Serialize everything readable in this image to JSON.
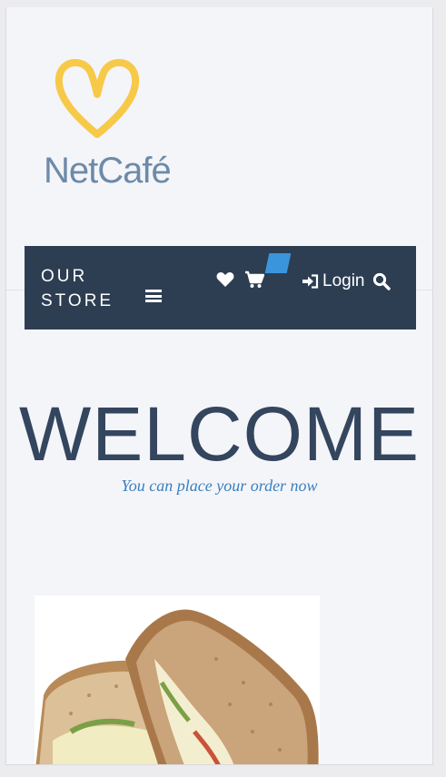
{
  "brand": {
    "name": "NetCafé",
    "logo_icon": "heart-outline-icon",
    "logo_color": "#f7c948"
  },
  "nav": {
    "store_line1": "OUR",
    "store_line2": "STORE",
    "menu_icon": "hamburger-icon",
    "wishlist_icon": "heart-icon",
    "cart_icon": "cart-icon",
    "login_icon": "sign-in-icon",
    "login_label": "Login",
    "search_icon": "search-icon",
    "background": "#2d3e52",
    "badge_color": "#3a95dc"
  },
  "hero": {
    "title": "WELCOME",
    "subtitle": "You can place your order now"
  },
  "product": {
    "image": "sandwich-image"
  }
}
